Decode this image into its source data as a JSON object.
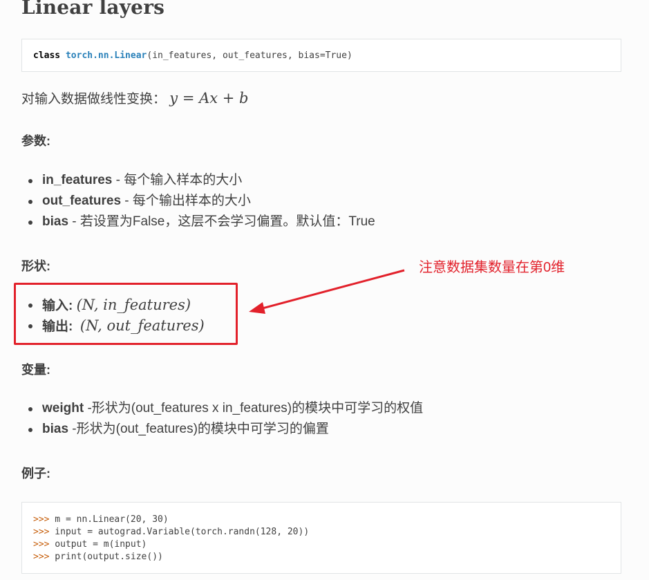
{
  "title": "Linear layers",
  "signature": {
    "keyword": "class",
    "name": "torch.nn.Linear",
    "params": "(in_features, out_features, bias=True)"
  },
  "description": "对输入数据做线性变换：",
  "description_formula": "y = Ax + b",
  "params_heading": "参数:",
  "params": [
    {
      "name": "in_features",
      "desc": " - 每个输入样本的大小"
    },
    {
      "name": "out_features",
      "desc": " - 每个输出样本的大小"
    },
    {
      "name": "bias",
      "desc": " - 若设置为False，这层不会学习偏置。默认值：True"
    }
  ],
  "shape_heading": "形状:",
  "shapes": [
    {
      "name": "输入:",
      "formula": "(N, in_features)"
    },
    {
      "name": "输出:",
      "formula": "(N, out_features)"
    }
  ],
  "annotation": {
    "text": "注意数据集数量在第0维",
    "color": "#e2212b"
  },
  "vars_heading": "变量:",
  "variables": [
    {
      "name": "weight",
      "desc": " -形状为(out_features x in_features)的模块中可学习的权值"
    },
    {
      "name": "bias",
      "desc": " -形状为(out_features)的模块中可学习的偏置"
    }
  ],
  "example_heading": "例子:",
  "code": [
    {
      "prompt": ">>>",
      "text": " m = nn.Linear(20, 30)"
    },
    {
      "prompt": ">>>",
      "text": " input = autograd.Variable(torch.randn(128, 20))"
    },
    {
      "prompt": ">>>",
      "text": " output = m(input)"
    },
    {
      "prompt": ">>>",
      "text": " print(output.size())"
    }
  ]
}
